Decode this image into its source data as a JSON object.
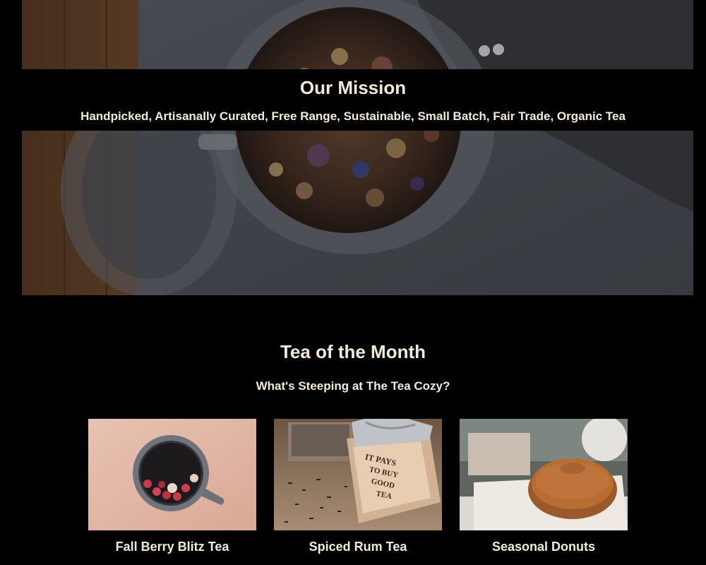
{
  "mission": {
    "title": "Our Mission",
    "text": "Handpicked, Artisanally Curated, Free Range, Sustainable, Small Batch, Fair Trade, Organic Tea"
  },
  "tea_of_month": {
    "title": "Tea of the Month",
    "subtitle": "What's Steeping at The Tea Cozy?",
    "items": [
      {
        "caption": "Fall Berry Blitz Tea"
      },
      {
        "caption": "Spiced Rum Tea"
      },
      {
        "caption": "Seasonal Donuts"
      }
    ]
  },
  "colors": {
    "background": "#000000",
    "text": "#f4ead9"
  }
}
